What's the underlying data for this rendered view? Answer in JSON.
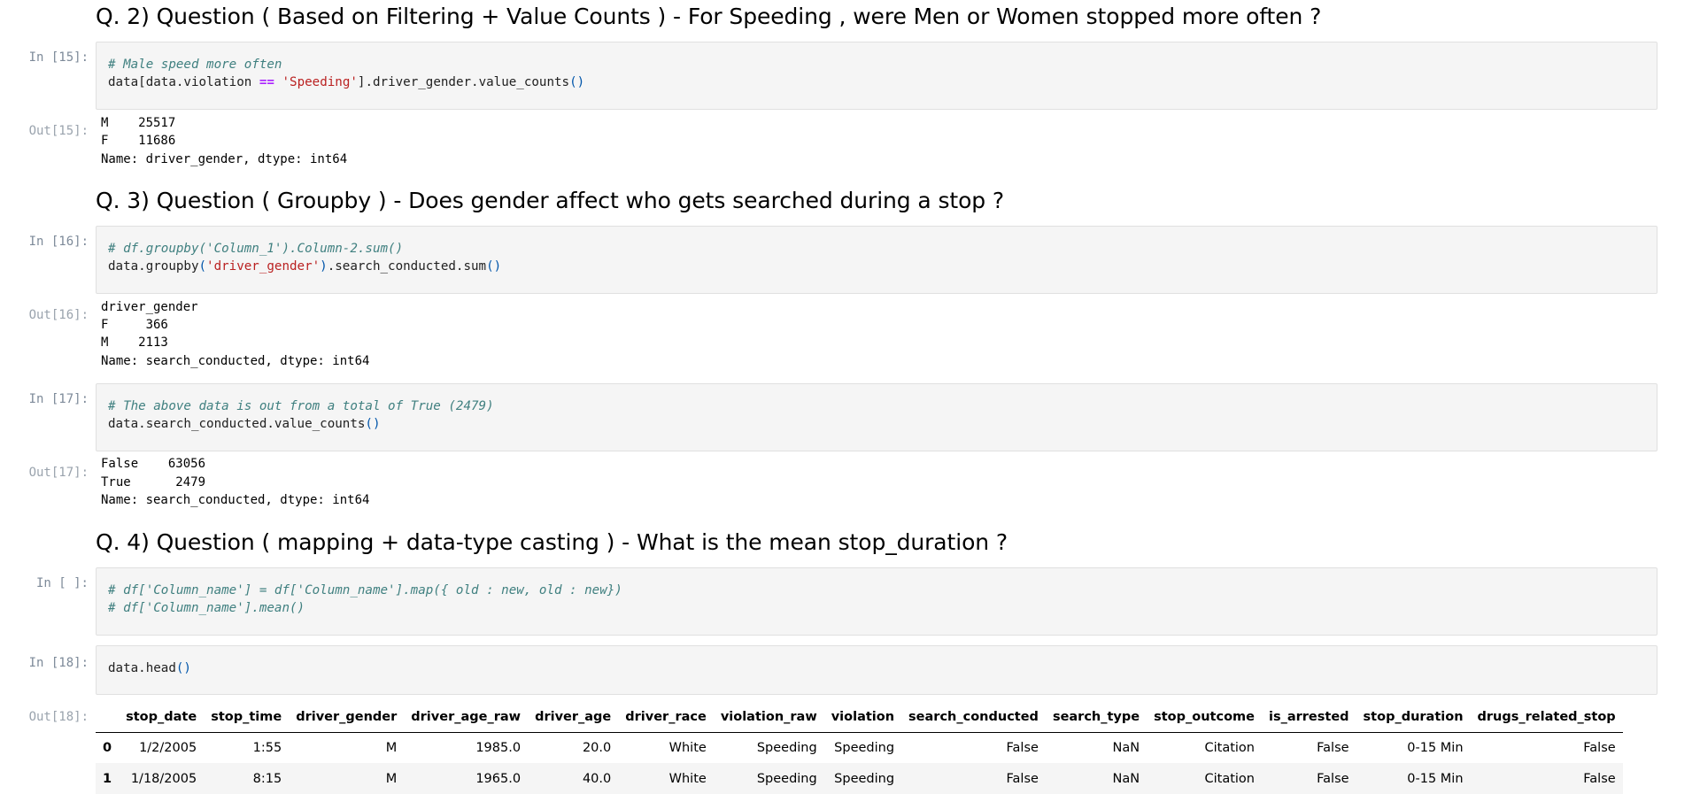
{
  "cells": {
    "q2_heading": "Q. 2) Question ( Based on Filtering + Value Counts ) - For Speeding , were Men or Women stopped more often ?",
    "in15": {
      "prompt": "In [15]:",
      "comment": "# Male speed more often",
      "code_a": "data[data.violation ",
      "code_op": "==",
      "code_str": "'Speeding'",
      "code_b": "].driver_gender.value_counts",
      "code_paren": "()"
    },
    "out15": {
      "prompt": "Out[15]:",
      "lines": [
        "M    25517",
        "F    11686",
        "Name: driver_gender, dtype: int64"
      ]
    },
    "q3_heading": "Q. 3) Question ( Groupby ) - Does gender affect who gets searched during a stop ?",
    "in16": {
      "prompt": "In [16]:",
      "comment": "# df.groupby('Column_1').Column-2.sum()",
      "code_a": "data.groupby",
      "code_p1": "(",
      "code_str": "'driver_gender'",
      "code_p2": ")",
      "code_b": ".search_conducted.sum",
      "code_paren": "()"
    },
    "out16": {
      "prompt": "Out[16]:",
      "lines": [
        "driver_gender",
        "F     366",
        "M    2113",
        "Name: search_conducted, dtype: int64"
      ]
    },
    "in17": {
      "prompt": "In [17]:",
      "comment": "# The above data is out from a total of True (2479)",
      "code_a": "data.search_conducted.value_counts",
      "code_paren": "()"
    },
    "out17": {
      "prompt": "Out[17]:",
      "lines": [
        "False    63056",
        "True      2479",
        "Name: search_conducted, dtype: int64"
      ]
    },
    "q4_heading": "Q. 4) Question ( mapping + data-type casting ) - What is the mean stop_duration ?",
    "in_empty": {
      "prompt": "In [ ]:",
      "line1": "# df['Column_name'] = df['Column_name'].map({ old : new, old : new})",
      "line2": "# df['Column_name'].mean()"
    },
    "in18": {
      "prompt": "In [18]:",
      "code_a": "data.head",
      "code_paren": "()"
    },
    "out18": {
      "prompt": "Out[18]:",
      "columns": [
        "",
        "stop_date",
        "stop_time",
        "driver_gender",
        "driver_age_raw",
        "driver_age",
        "driver_race",
        "violation_raw",
        "violation",
        "search_conducted",
        "search_type",
        "stop_outcome",
        "is_arrested",
        "stop_duration",
        "drugs_related_stop"
      ],
      "rows": [
        [
          "0",
          "1/2/2005",
          "1:55",
          "M",
          "1985.0",
          "20.0",
          "White",
          "Speeding",
          "Speeding",
          "False",
          "NaN",
          "Citation",
          "False",
          "0-15 Min",
          "False"
        ],
        [
          "1",
          "1/18/2005",
          "8:15",
          "M",
          "1965.0",
          "40.0",
          "White",
          "Speeding",
          "Speeding",
          "False",
          "NaN",
          "Citation",
          "False",
          "0-15 Min",
          "False"
        ]
      ]
    }
  }
}
